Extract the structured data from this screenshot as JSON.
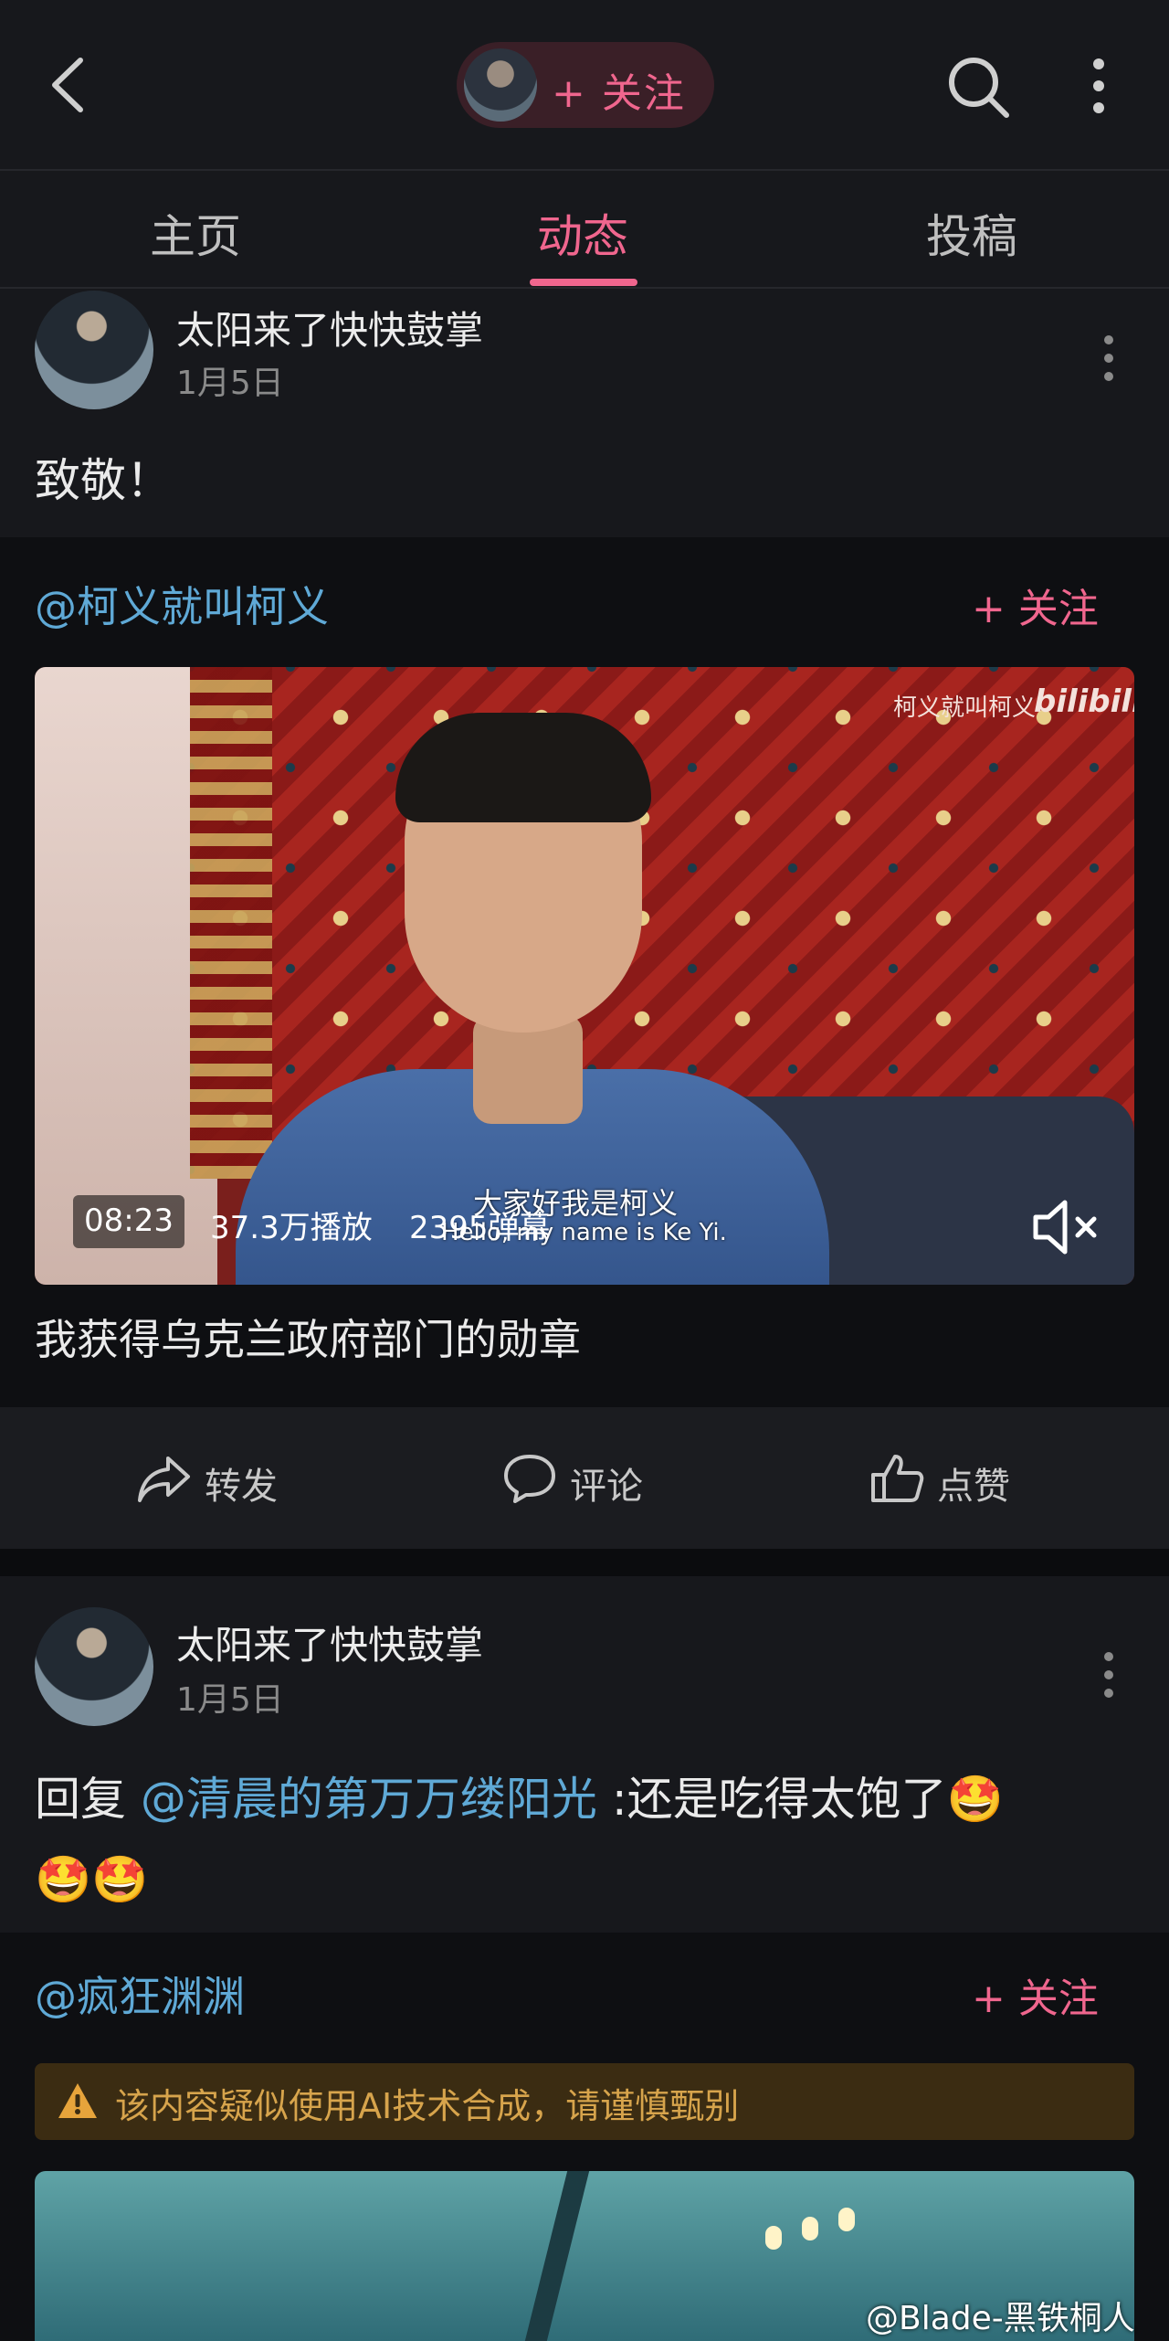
{
  "header": {
    "back_icon": "chevron-left-icon",
    "follow_label": "+ 关注",
    "search_icon": "search-icon",
    "more_icon": "more-vertical-icon"
  },
  "tabs": [
    {
      "label": "主页",
      "active": false
    },
    {
      "label": "动态",
      "active": true
    },
    {
      "label": "投稿",
      "active": false
    }
  ],
  "posts": [
    {
      "username": "太阳来了快快鼓掌",
      "date": "1月5日",
      "text": "致敬！",
      "forward": {
        "author": "@柯义就叫柯义",
        "follow_label": "+ 关注",
        "video": {
          "watermark_text": "柯义就叫柯义",
          "watermark_logo": "bilibili",
          "subtitle_cn": "大家好我是柯义",
          "subtitle_en": "Hello, my name is Ke Yi.",
          "duration": "08:23",
          "plays": "37.3万播放",
          "danmaku": "2395弹幕",
          "mute_icon": "mute-icon"
        },
        "title": "我获得乌克兰政府部门的勋章"
      },
      "actions": {
        "repost": "转发",
        "comment": "评论",
        "like": "点赞"
      }
    },
    {
      "username": "太阳来了快快鼓掌",
      "date": "1月5日",
      "reply_prefix": "回复",
      "reply_mention": "@清晨的第万万缕阳光",
      "reply_text": ":还是吃得太饱了",
      "emoji": "🤩",
      "forward": {
        "author": "@疯狂渊渊",
        "follow_label": "+ 关注",
        "ai_warning": "该内容疑似使用AI技术合成，请谨慎甄别"
      }
    }
  ],
  "watermark": "@Blade-黑铁桐人",
  "colors": {
    "accent": "#f0668e",
    "mention": "#5fa9d6",
    "background": "#17181c",
    "warning": "#d7a44c"
  }
}
